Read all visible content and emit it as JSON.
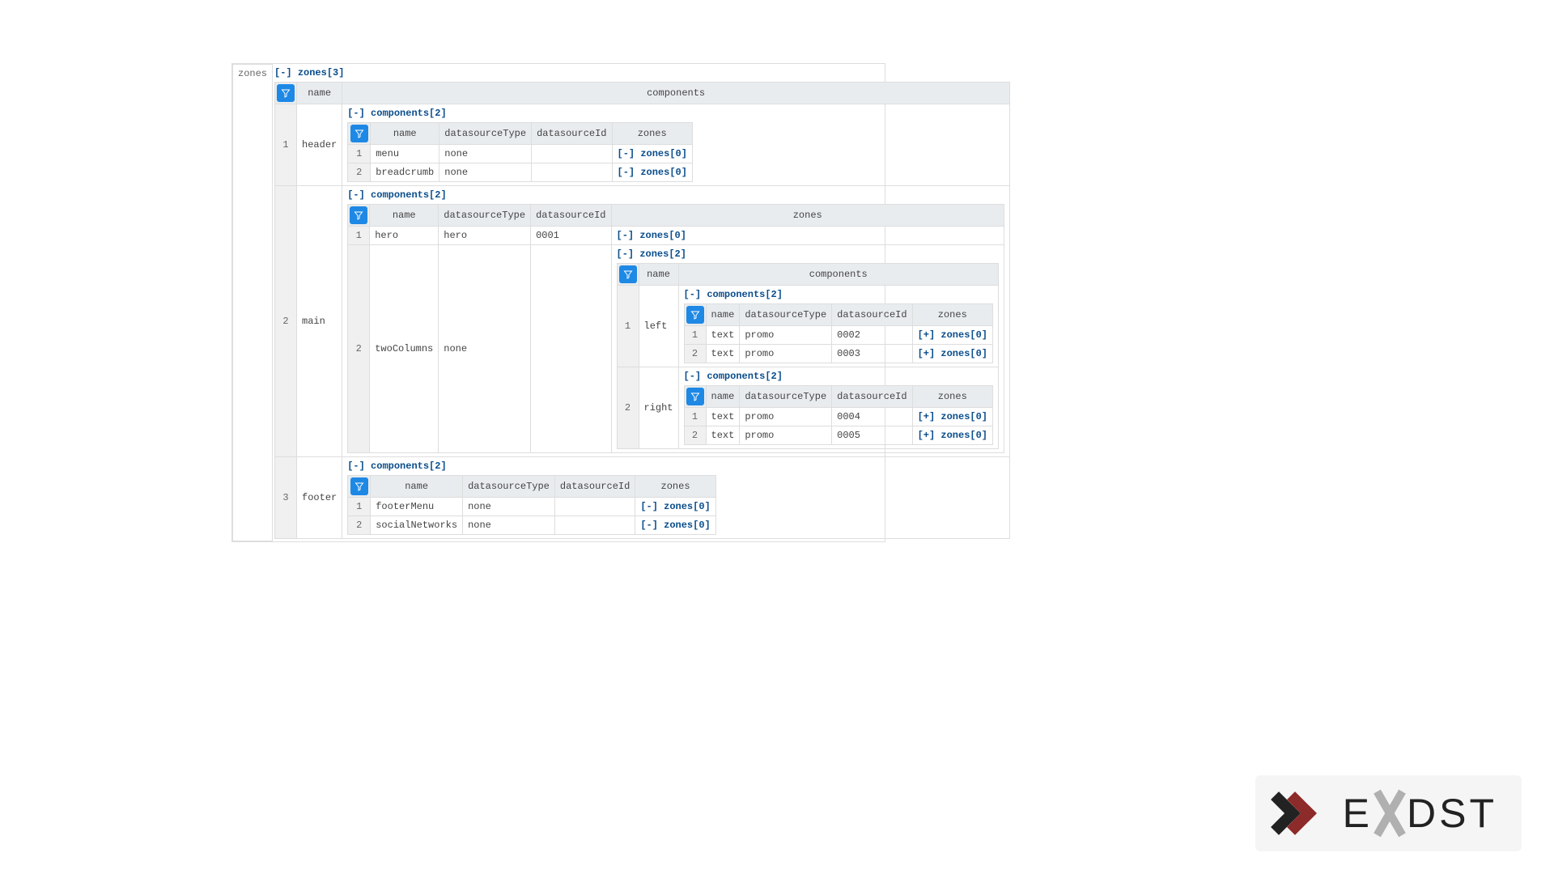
{
  "rootLabel": "zones",
  "rootArray": "zones[3]",
  "headers": {
    "name": "name",
    "components": "components",
    "datasourceType": "datasourceType",
    "datasourceId": "datasourceId",
    "zones": "zones"
  },
  "toggle": {
    "collapse": "[-]",
    "expand": "[+]"
  },
  "componentsHdr": "components[2]",
  "zones3": {
    "1": {
      "name": "header",
      "comps": {
        "1": {
          "name": "menu",
          "dst": "none",
          "dsi": "",
          "zones": "zones[0]",
          "open": true
        },
        "2": {
          "name": "breadcrumb",
          "dst": "none",
          "dsi": "",
          "zones": "zones[0]",
          "open": true
        }
      }
    },
    "2": {
      "name": "main",
      "comps": {
        "1": {
          "name": "hero",
          "dst": "hero",
          "dsi": "0001",
          "zones": "zones[0]",
          "open": true
        },
        "2": {
          "name": "twoColumns",
          "dst": "none",
          "dsi": "",
          "zonesOpen": true,
          "zones": "zones[2]",
          "sub": {
            "1": {
              "name": "left",
              "comps": {
                "1": {
                  "name": "text",
                  "dst": "promo",
                  "dsi": "0002",
                  "zones": "zones[0]",
                  "open": false
                },
                "2": {
                  "name": "text",
                  "dst": "promo",
                  "dsi": "0003",
                  "zones": "zones[0]",
                  "open": false
                }
              }
            },
            "2": {
              "name": "right",
              "comps": {
                "1": {
                  "name": "text",
                  "dst": "promo",
                  "dsi": "0004",
                  "zones": "zones[0]",
                  "open": false
                },
                "2": {
                  "name": "text",
                  "dst": "promo",
                  "dsi": "0005",
                  "zones": "zones[0]",
                  "open": false
                }
              }
            }
          }
        }
      }
    },
    "3": {
      "name": "footer",
      "comps": {
        "1": {
          "name": "footerMenu",
          "dst": "none",
          "dsi": "",
          "zones": "zones[0]",
          "open": true
        },
        "2": {
          "name": "socialNetworks",
          "dst": "none",
          "dsi": "",
          "zones": "zones[0]",
          "open": true
        }
      }
    }
  },
  "logo": {
    "brand_e": "E",
    "brand_dst": "DST"
  }
}
